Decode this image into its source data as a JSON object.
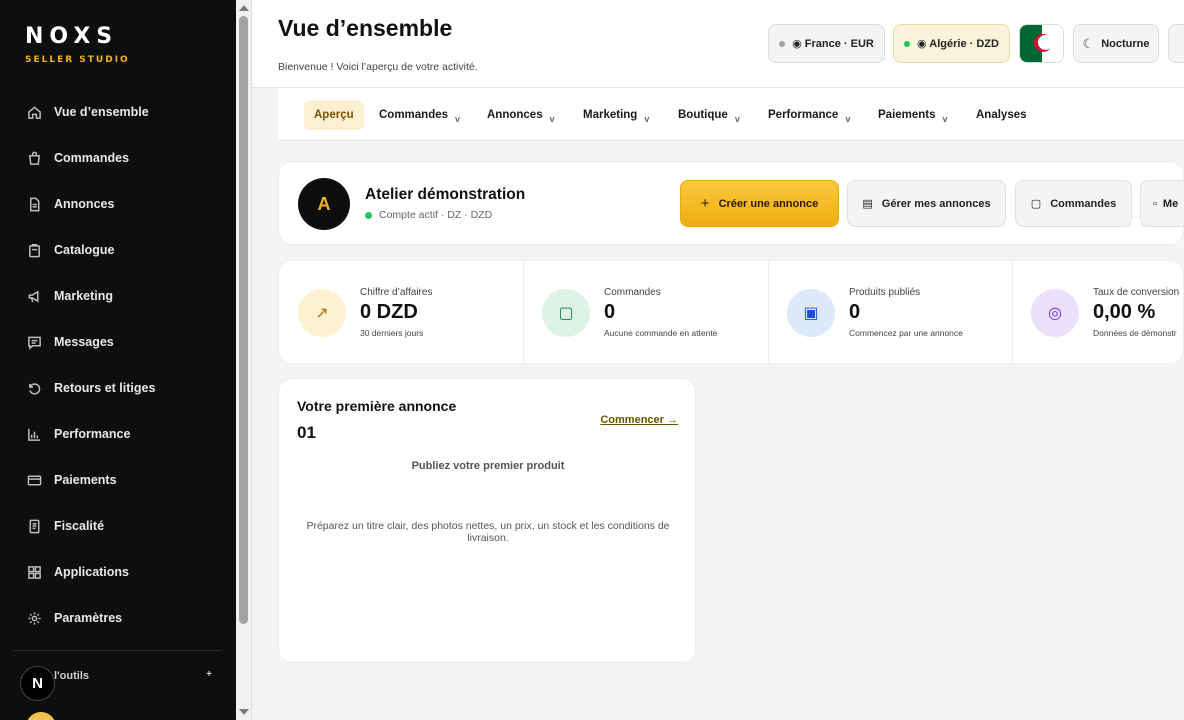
{
  "brand": {
    "name": "NOXS",
    "subtitle": "SELLER STUDIO"
  },
  "sidebar": {
    "items": [
      {
        "label": "Vue d’ensemble",
        "icon": "home-icon"
      },
      {
        "label": "Commandes",
        "icon": "bag-icon"
      },
      {
        "label": "Annonces",
        "icon": "document-icon"
      },
      {
        "label": "Catalogue",
        "icon": "clipboard-icon"
      },
      {
        "label": "Marketing",
        "icon": "megaphone-icon"
      },
      {
        "label": "Messages",
        "icon": "chat-icon"
      },
      {
        "label": "Retours et litiges",
        "icon": "return-icon"
      },
      {
        "label": "Performance",
        "icon": "bar-chart-icon"
      },
      {
        "label": "Paiements",
        "icon": "card-icon"
      },
      {
        "label": "Fiscalité",
        "icon": "receipt-icon"
      },
      {
        "label": "Applications",
        "icon": "grid-icon"
      },
      {
        "label": "Paramètres",
        "icon": "gear-icon"
      }
    ],
    "tools_label": "l'outils",
    "tools_plus": "+",
    "badge_letter": "N"
  },
  "header": {
    "title": "Vue d’ensemble",
    "subtitle": "Bienvenue ! Voici l’aperçu de votre activité.",
    "market_france": "◉ France · EUR",
    "market_algeria": "◉ Algérie · DZD",
    "theme_moon": "☾",
    "theme_label": "Nocturne",
    "colors": {
      "accent": "#f2b21c",
      "status_green": "#22c55e"
    }
  },
  "tabs": [
    {
      "label": "Aperçu",
      "active": true
    },
    {
      "label": "Commandes",
      "chevron": "v"
    },
    {
      "label": "Annonces",
      "chevron": "v"
    },
    {
      "label": "Marketing",
      "chevron": "v"
    },
    {
      "label": "Boutique",
      "chevron": "v"
    },
    {
      "label": "Performance",
      "chevron": "v"
    },
    {
      "label": "Paiements",
      "chevron": "v"
    },
    {
      "label": "Analyses"
    }
  ],
  "shop": {
    "avatar_letter": "A",
    "name": "Atelier démonstration",
    "status": "Compte actif · DZ · DZD",
    "actions": {
      "create": {
        "icon": "+",
        "label": "Créer une annonce"
      },
      "manage": {
        "icon": "▤",
        "label": "Gérer mes annonces"
      },
      "orders": {
        "icon": "▢",
        "label": "Commandes"
      },
      "more": {
        "icon": "▫",
        "label": "Me"
      }
    }
  },
  "kpis": [
    {
      "label": "Chiffre d’affaires",
      "value": "0 DZD",
      "sub": "30 derniers jours",
      "icon": "↗"
    },
    {
      "label": "Commandes",
      "value": "0",
      "sub": "Aucune commande en attente",
      "icon": "▢"
    },
    {
      "label": "Produits publiés",
      "value": "0",
      "sub": "Commencez par une annonce",
      "icon": "▣"
    },
    {
      "label": "Taux de conversion",
      "value": "0,00 %",
      "sub": "Données de démonstr",
      "icon": "◎"
    }
  ],
  "first_listing": {
    "title": "Votre première annonce",
    "number": "01",
    "link": "Commencer →",
    "heading": "Publiez votre premier produit",
    "description": "Préparez un titre clair, des photos nettes, un prix, un stock et les conditions de livraison."
  }
}
